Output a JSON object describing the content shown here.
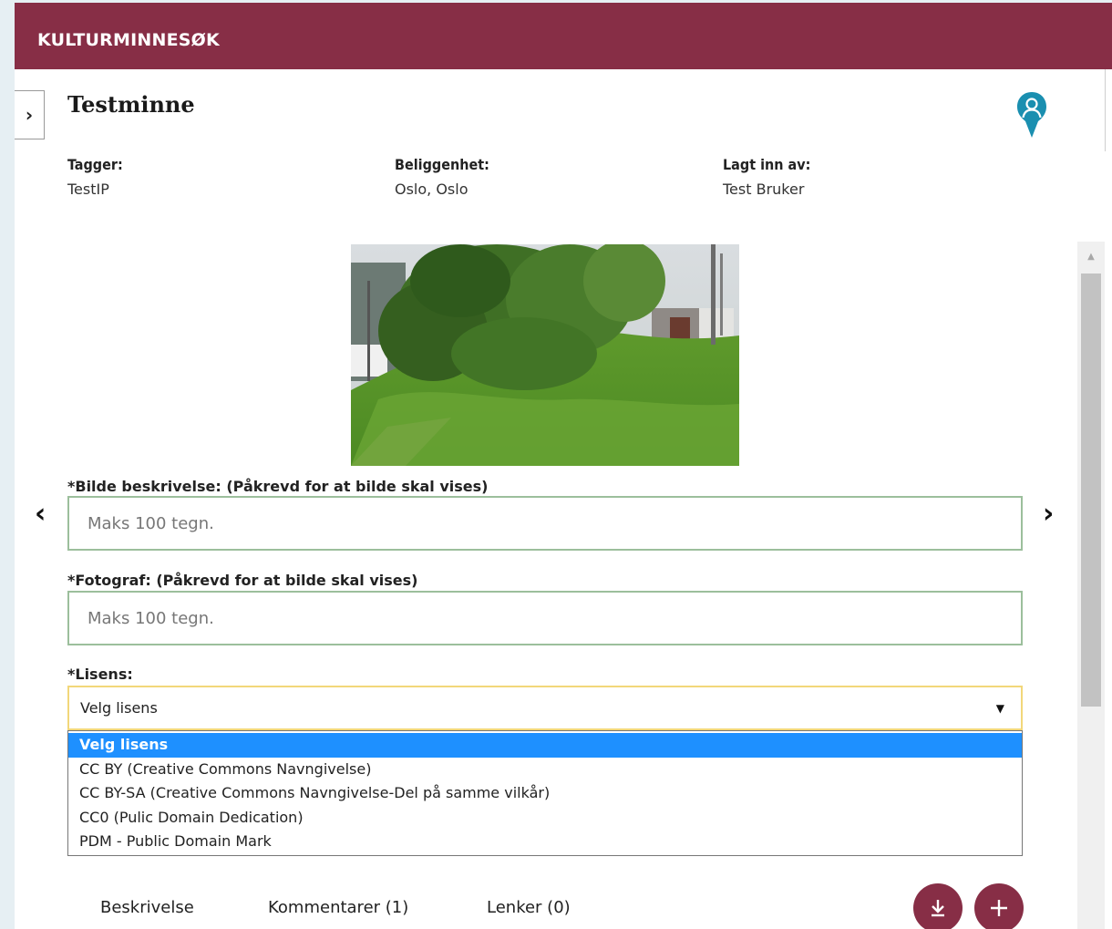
{
  "header": {
    "title": "KULTURMINNESØK"
  },
  "panel": {
    "toggle_icon": "›",
    "title": "Testminne",
    "map_pin_icon": "map-pin-person-icon"
  },
  "meta": {
    "tags_label": "Tagger:",
    "tags_value": "TestIP",
    "location_label": "Beliggenhet:",
    "location_value": "Oslo, Oslo",
    "added_by_label": "Lagt inn av:",
    "added_by_value": "Test Bruker"
  },
  "carousel": {
    "prev_icon": "‹",
    "next_icon": "›"
  },
  "form": {
    "description_label": "*Bilde beskrivelse: (Påkrevd for at bilde skal vises)",
    "description_placeholder": "Maks 100 tegn.",
    "description_value": "",
    "photographer_label": "*Fotograf: (Påkrevd for at bilde skal vises)",
    "photographer_placeholder": "Maks 100 tegn.",
    "photographer_value": "",
    "license_label": "*Lisens:",
    "license_selected": "Velg lisens",
    "license_options": [
      "Velg lisens",
      "CC BY (Creative Commons Navngivelse)",
      "CC BY-SA (Creative Commons Navngivelse-Del på samme vilkår)",
      "CC0 (Pulic Domain Dedication)",
      "PDM - Public Domain Mark"
    ]
  },
  "tabs": {
    "description": "Beskrivelse",
    "comments": "Kommentarer (1)",
    "links": "Lenker (0)"
  },
  "actions": {
    "download_icon": "download-icon",
    "add_icon": "plus-icon"
  },
  "colors": {
    "brand": "#872e46",
    "pin": "#1a8fb0",
    "selected_option": "#1e90ff",
    "input_border": "#9cbf9c",
    "select_border": "#f2d77a"
  }
}
